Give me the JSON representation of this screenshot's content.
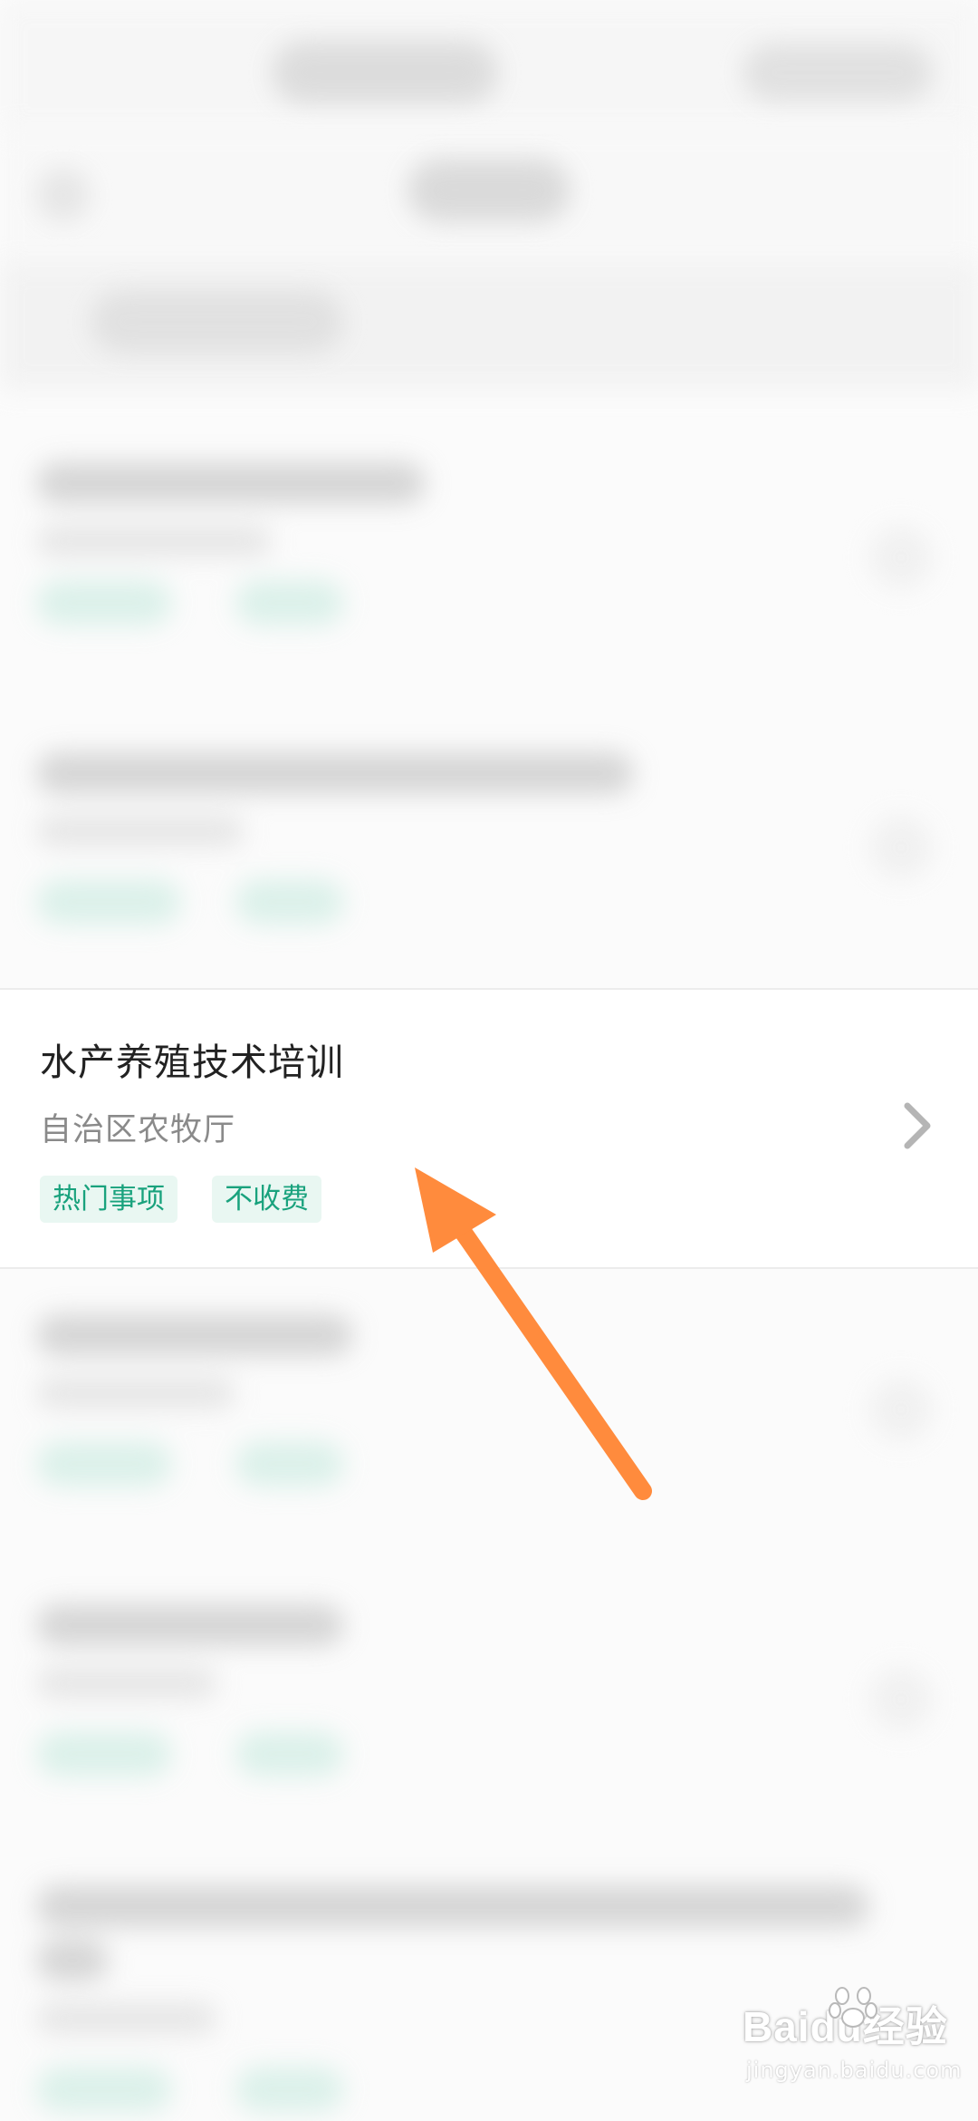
{
  "screen": {
    "focused_item": {
      "title": "水产养殖技术培训",
      "department": "自治区农牧厅",
      "tags": [
        "热门事项",
        "不收费"
      ],
      "chevron_icon": "chevron-right-icon"
    },
    "annotation": {
      "arrow_icon": "arrow-icon",
      "arrow_color": "#ff8b3d"
    },
    "watermark": {
      "brand": "Baidu经验",
      "domain": "jingyan.baidu.com"
    },
    "colors": {
      "tag_text": "#19a27d",
      "tag_bg": "#e9f7f2"
    }
  }
}
